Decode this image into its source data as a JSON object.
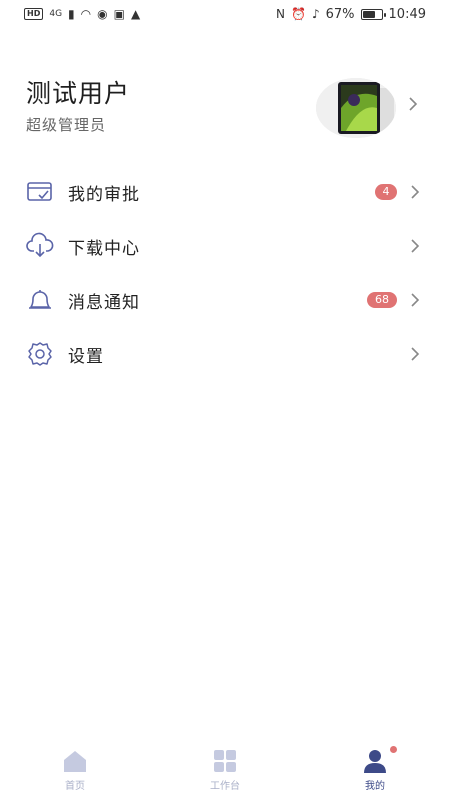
{
  "status_bar": {
    "left_hd": "HD",
    "left_network": "4G",
    "right_battery_percent": "67%",
    "time": "10:49",
    "battery_level": 0.67
  },
  "profile": {
    "name": "测试用户",
    "role": "超级管理员"
  },
  "menu": [
    {
      "label": "我的审批",
      "icon": "approval-icon",
      "badge": "4"
    },
    {
      "label": "下载中心",
      "icon": "cloud-download-icon",
      "badge": ""
    },
    {
      "label": "消息通知",
      "icon": "bell-icon",
      "badge": "68"
    },
    {
      "label": "设置",
      "icon": "gear-icon",
      "badge": ""
    }
  ],
  "tabbar": [
    {
      "label": "首页",
      "icon": "home-icon",
      "active": false
    },
    {
      "label": "工作台",
      "icon": "grid-icon",
      "active": false
    },
    {
      "label": "我的",
      "icon": "user-icon",
      "active": true
    }
  ],
  "colors": {
    "accent": "#3d4a88",
    "icon_line": "#5a64a8",
    "badge": "#e07373",
    "tab_inactive": "#aab0c8"
  }
}
